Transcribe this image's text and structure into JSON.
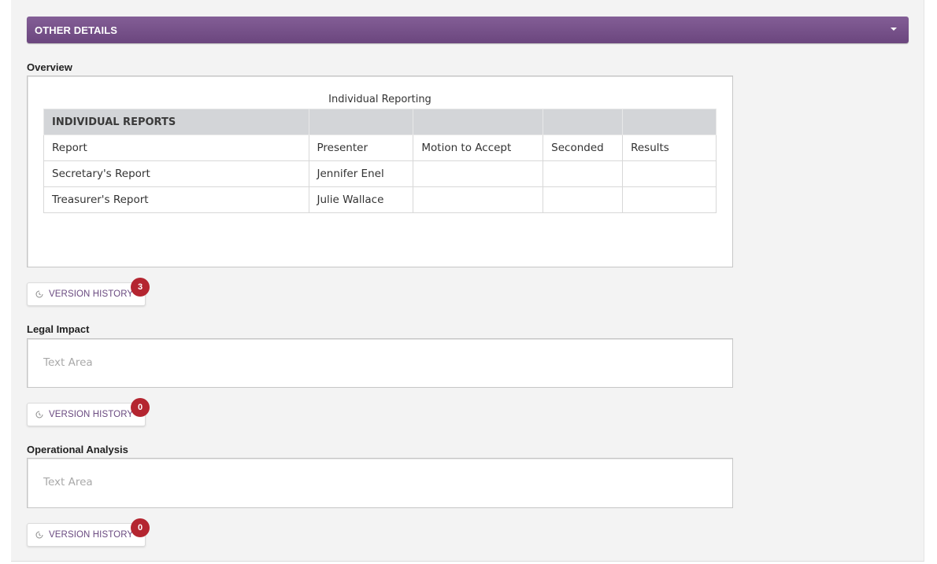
{
  "header": {
    "title": "OTHER DETAILS",
    "icon": "caret-down-icon",
    "background_color": "#7a5590"
  },
  "overview": {
    "label": "Overview",
    "caption": "Individual Reporting",
    "table": {
      "section_header": "INDIVIDUAL REPORTS",
      "columns": [
        "Report",
        "Presenter",
        "Motion to Accept",
        "Seconded",
        "Results"
      ],
      "rows": [
        [
          "Secretary's Report",
          "Jennifer Enel",
          "",
          "",
          ""
        ],
        [
          "Treasurer's Report",
          "Julie Wallace",
          "",
          "",
          ""
        ]
      ]
    },
    "version_history": {
      "label": "VERSION HISTORY",
      "count": "3",
      "icon": "history-clock-icon"
    }
  },
  "legal_impact": {
    "label": "Legal Impact",
    "placeholder": "Text Area",
    "version_history": {
      "label": "VERSION HISTORY",
      "count": "0",
      "icon": "history-clock-icon"
    }
  },
  "operational_analysis": {
    "label": "Operational Analysis",
    "placeholder": "Text Area",
    "version_history": {
      "label": "VERSION HISTORY",
      "count": "0",
      "icon": "history-clock-icon"
    }
  },
  "colors": {
    "badge": "#b42530",
    "button_text": "#6a4a80",
    "table_header": "#d3d5d8"
  }
}
